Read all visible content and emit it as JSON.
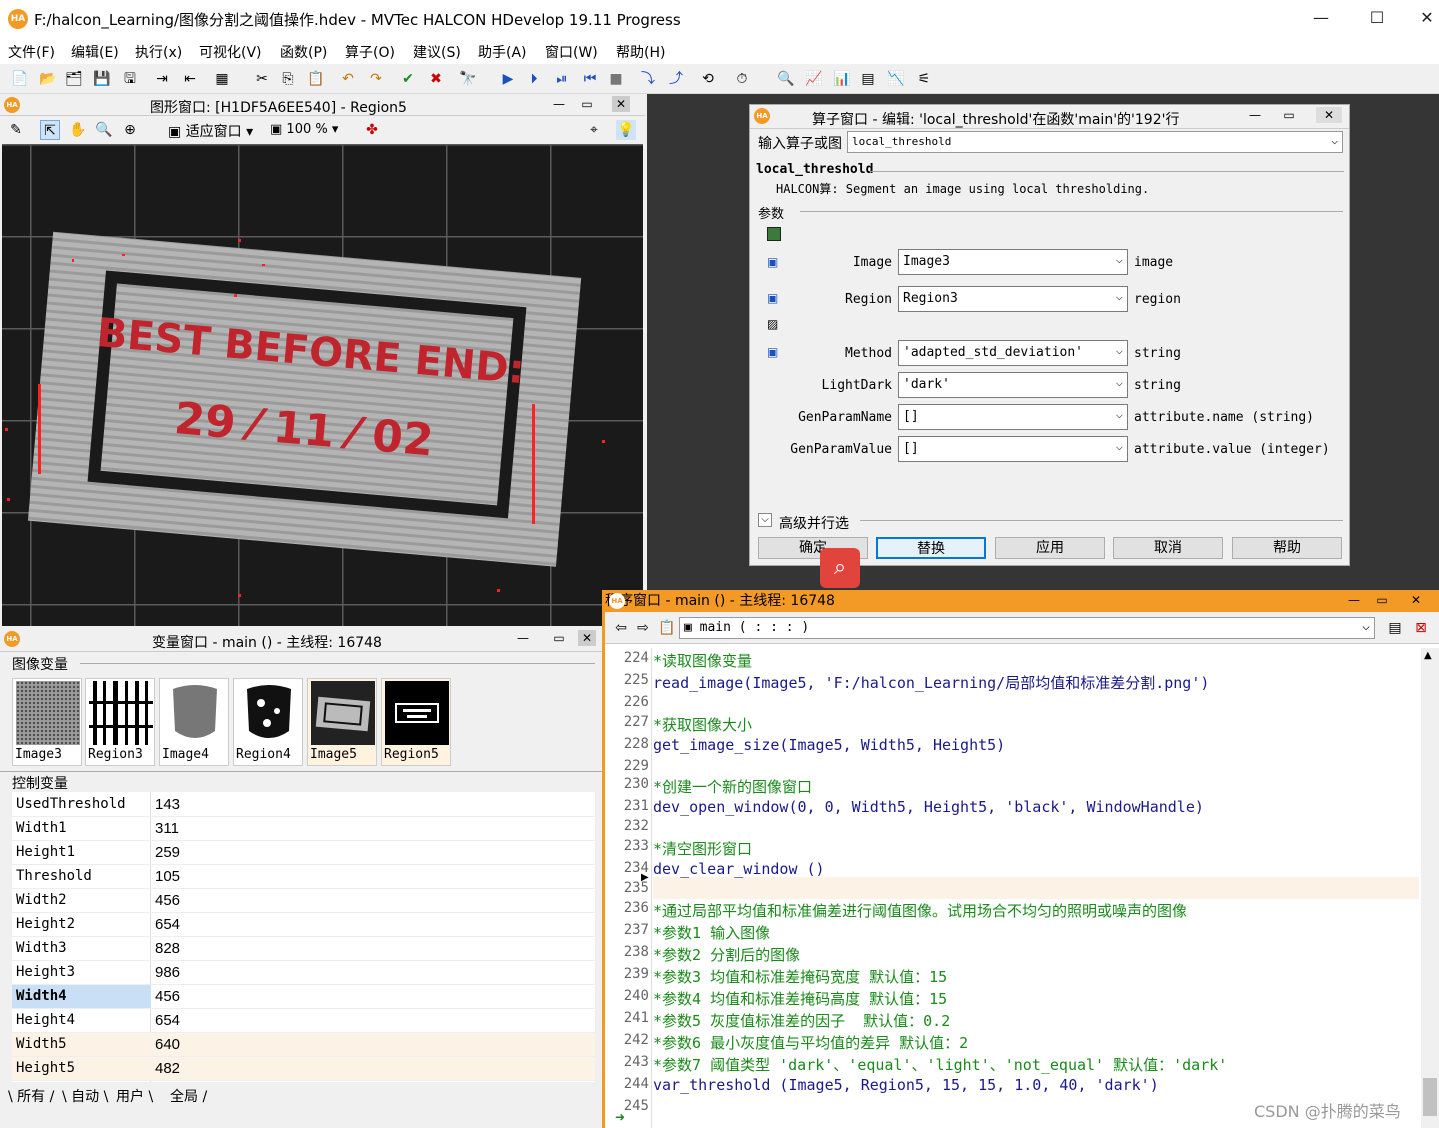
{
  "window": {
    "title": "F:/halcon_Learning/图像分割之阈值操作.hdev - MVTec HALCON HDevelop 19.11 Progress",
    "app_icon": "HA"
  },
  "menu": [
    "文件(F)",
    "编辑(E)",
    "执行(x)",
    "可视化(V)",
    "函数(P)",
    "算子(O)",
    "建议(S)",
    "助手(A)",
    "窗口(W)",
    "帮助(H)"
  ],
  "graphics_window": {
    "title": "图形窗口: [H1DF5A6EE540] - Region5",
    "fit_label": "适应窗口",
    "zoom": "100 %",
    "image_text_line1": "BEST BEFORE END:",
    "image_text_line2": "29 ⁄ 11 ⁄ 02"
  },
  "operator_window": {
    "title": "算子窗口 - 编辑: 'local_threshold'在函数'main'的'192'行",
    "input_label": "输入算子或图",
    "input_value": "local_threshold",
    "op_name": "local_threshold",
    "op_desc": "HALCON算: Segment an image using local thresholding.",
    "params_label": "参数",
    "params": [
      {
        "name": "Image",
        "value": "Image3",
        "type": "image"
      },
      {
        "name": "Region",
        "value": "Region3",
        "type": "region"
      },
      {
        "name": "Method",
        "value": "'adapted_std_deviation'",
        "type": "string"
      },
      {
        "name": "LightDark",
        "value": "'dark'",
        "type": "string"
      },
      {
        "name": "GenParamName",
        "value": "[]",
        "type": "attribute.name (string)"
      },
      {
        "name": "GenParamValue",
        "value": "[]",
        "type": "attribute.value (integer)"
      }
    ],
    "advanced_label": "高级并行选",
    "buttons": {
      "ok": "确定",
      "replace": "替换",
      "apply": "应用",
      "cancel": "取消",
      "help": "帮助"
    }
  },
  "variable_window": {
    "title": "变量窗口 - main () - 主线程: 16748",
    "image_vars_label": "图像变量",
    "images": [
      "Image3",
      "Region3",
      "Image4",
      "Region4",
      "Image5",
      "Region5"
    ],
    "control_vars_label": "控制变量",
    "controls": [
      {
        "name": "UsedThreshold",
        "value": "143"
      },
      {
        "name": "Width1",
        "value": "311"
      },
      {
        "name": "Height1",
        "value": "259"
      },
      {
        "name": "Threshold",
        "value": "105"
      },
      {
        "name": "Width2",
        "value": "456"
      },
      {
        "name": "Height2",
        "value": "654"
      },
      {
        "name": "Width3",
        "value": "828"
      },
      {
        "name": "Height3",
        "value": "986"
      },
      {
        "name": "Width4",
        "value": "456"
      },
      {
        "name": "Height4",
        "value": "654"
      },
      {
        "name": "Width5",
        "value": "640"
      },
      {
        "name": "Height5",
        "value": "482"
      }
    ],
    "tabs": [
      "所有",
      "自动",
      "用户",
      "全局"
    ]
  },
  "program_window": {
    "title": "程序窗口 - main () - 主线程: 16748",
    "proc_select": "main ( : : : )",
    "lines": [
      {
        "n": "224",
        "text": "*读取图像变量",
        "comment": true
      },
      {
        "n": "225",
        "text": "read_image(Image5, 'F:/halcon_Learning/局部均值和标准差分割.png')",
        "comment": false
      },
      {
        "n": "226",
        "text": "",
        "comment": false
      },
      {
        "n": "227",
        "text": "*获取图像大小",
        "comment": true
      },
      {
        "n": "228",
        "text": "get_image_size(Image5, Width5, Height5)",
        "comment": false
      },
      {
        "n": "229",
        "text": "",
        "comment": false
      },
      {
        "n": "230",
        "text": "*创建一个新的图像窗口",
        "comment": true
      },
      {
        "n": "231",
        "text": "dev_open_window(0, 0, Width5, Height5, 'black', WindowHandle)",
        "comment": false
      },
      {
        "n": "232",
        "text": "",
        "comment": false
      },
      {
        "n": "233",
        "text": "*清空图形窗口",
        "comment": true
      },
      {
        "n": "234",
        "text": "dev_clear_window ()",
        "comment": false
      },
      {
        "n": "235",
        "text": "",
        "comment": false
      },
      {
        "n": "236",
        "text": "*通过局部平均值和标准偏差进行阈值图像。试用场合不均匀的照明或噪声的图像",
        "comment": true
      },
      {
        "n": "237",
        "text": "*参数1 输入图像",
        "comment": true
      },
      {
        "n": "238",
        "text": "*参数2 分割后的图像",
        "comment": true
      },
      {
        "n": "239",
        "text": "*参数3 均值和标准差掩码宽度 默认值：15",
        "comment": true
      },
      {
        "n": "240",
        "text": "*参数4 均值和标准差掩码高度 默认值：15",
        "comment": true
      },
      {
        "n": "241",
        "text": "*参数5 灰度值标准差的因子  默认值：0.2",
        "comment": true
      },
      {
        "n": "242",
        "text": "*参数6 最小灰度值与平均值的差异 默认值：2",
        "comment": true
      },
      {
        "n": "243",
        "text": "*参数7 阈值类型 'dark'、'equal'、'light'、'not_equal' 默认值：'dark'",
        "comment": true
      },
      {
        "n": "244",
        "text": "var_threshold (Image5, Region5, 15, 15, 1.0, 40, 'dark')",
        "comment": false
      },
      {
        "n": "245",
        "text": "",
        "comment": false
      }
    ]
  },
  "watermark": "CSDN @扑腾的菜鸟"
}
